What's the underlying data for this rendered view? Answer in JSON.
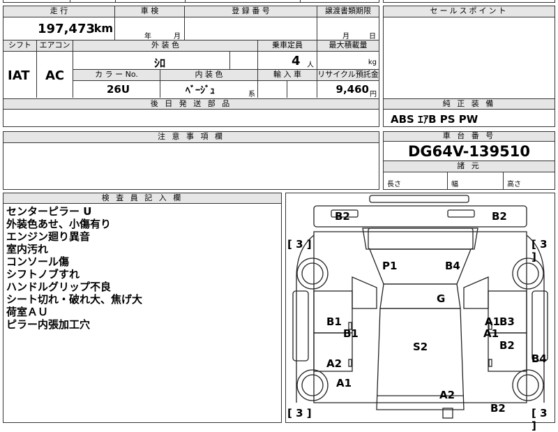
{
  "top": {
    "mileage_header": "走 行",
    "mileage_value": "197,473",
    "mileage_unit": "km",
    "inspection_header": "車 検",
    "inspection_year": "年",
    "inspection_month": "月",
    "registration_header": "登 録 番 号",
    "transfer_header": "譲渡書類期限",
    "transfer_month": "月",
    "transfer_day": "日"
  },
  "middle": {
    "shift_header": "シフト",
    "shift_value": "IAT",
    "ac_header": "エアコン",
    "ac_value": "AC",
    "exterior_header": "外 装 色",
    "exterior_value": "ｼﾛ",
    "capacity_header": "乗車定員",
    "capacity_value": "4",
    "capacity_unit": "人",
    "max_load_header": "最大積載量",
    "max_load_unit": "kg",
    "color_no_header": "カ ラ ー No.",
    "color_no_value": "26U",
    "interior_header": "内 装 色",
    "interior_value": "ﾍﾞｰｼﾞｭ",
    "interior_suffix": "系",
    "import_header": "輸 入 車",
    "recycle_header": "リサイクル預託金",
    "recycle_value": "9,460",
    "recycle_unit": "円"
  },
  "later_parts_header": "後 日 発 送 部 品",
  "sales_point_header": "セールスポイント",
  "equipment": {
    "header": "純 正 装 備",
    "value": "ABS ｴｱB PS PW"
  },
  "caution_header": "注 意 事 項 欄",
  "chassis": {
    "header": "車 台 番 号",
    "value": "DG64V-139510",
    "dims_header": "諸 元",
    "length": "長さ",
    "width": "幅",
    "height": "高さ"
  },
  "inspector": {
    "header": "検 査 員 記 入 欄",
    "lines": [
      "センターピラー U",
      "外装色あせ、小傷有り",
      "エンジン廻り異音",
      "室内汚れ",
      "コンソール傷",
      "シフトノブすれ",
      "ハンドルグリップ不良",
      "シート切れ・破れ大、焦げ大",
      "荷室ＡＵ",
      "ピラー内張加工穴"
    ]
  },
  "diagram": {
    "bracket_tl": "[ 3 ]",
    "bracket_tr": "[ 3 ]",
    "bracket_bl": "[ 3 ]",
    "bracket_br": "[ 3 ]",
    "marks": {
      "b2_tl": "B2",
      "b2_tr": "B2",
      "p1": "P1",
      "b4_top": "B4",
      "g": "G",
      "b1_left": "B1",
      "b1_left2": "B1",
      "a1_right": "A1",
      "b3_right": "B3",
      "a1_right2": "A1",
      "b2_right": "B2",
      "s2": "S2",
      "b4_right": "B4",
      "a2_left": "A2",
      "a1_left": "A1",
      "a2_bottom": "A2",
      "b2_bottom": "B2"
    }
  }
}
